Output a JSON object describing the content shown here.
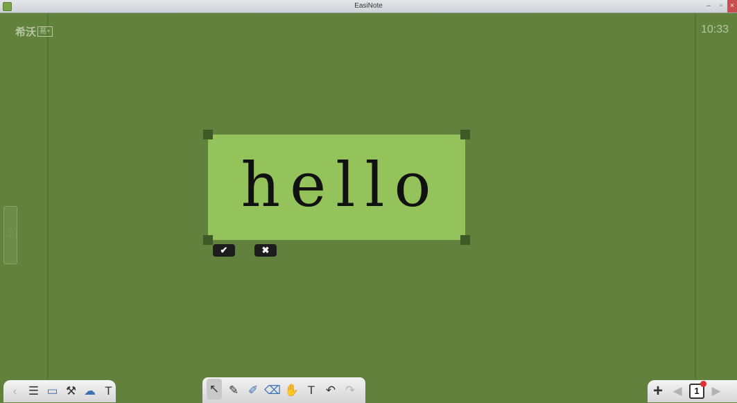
{
  "window": {
    "title": "EasiNote",
    "min_label": "–",
    "max_label": "▫",
    "close_label": "×"
  },
  "board": {
    "logo_text": "希沃",
    "logo_box": "易+",
    "clock": "10:33",
    "side_handle_glyph": "⋮⋮"
  },
  "selection": {
    "text": "hello",
    "confirm_glyph": "✔",
    "cancel_glyph": "✖"
  },
  "toolbar_left": [
    {
      "name": "collapse-left-icon",
      "glyph": "‹"
    },
    {
      "name": "menu-icon",
      "glyph": "☰"
    },
    {
      "name": "screen-icon",
      "glyph": "▭"
    },
    {
      "name": "tools-icon",
      "glyph": "⚒"
    },
    {
      "name": "cloud-icon",
      "glyph": "☁"
    },
    {
      "name": "courseware-icon",
      "glyph": "T"
    }
  ],
  "toolbar_center": [
    {
      "name": "select-tool-icon",
      "glyph": "↖"
    },
    {
      "name": "pen-tool-icon",
      "glyph": "✎"
    },
    {
      "name": "brush-tool-icon",
      "glyph": "✐"
    },
    {
      "name": "eraser-tool-icon",
      "glyph": "⌫"
    },
    {
      "name": "hand-tool-icon",
      "glyph": "✋"
    },
    {
      "name": "text-tool-icon",
      "glyph": "T"
    },
    {
      "name": "undo-icon",
      "glyph": "↶"
    },
    {
      "name": "redo-icon",
      "glyph": "↷"
    }
  ],
  "toolbar_right": {
    "add_glyph": "+",
    "prev_glyph": "◀",
    "page_number": "1",
    "next_glyph": "▶"
  }
}
